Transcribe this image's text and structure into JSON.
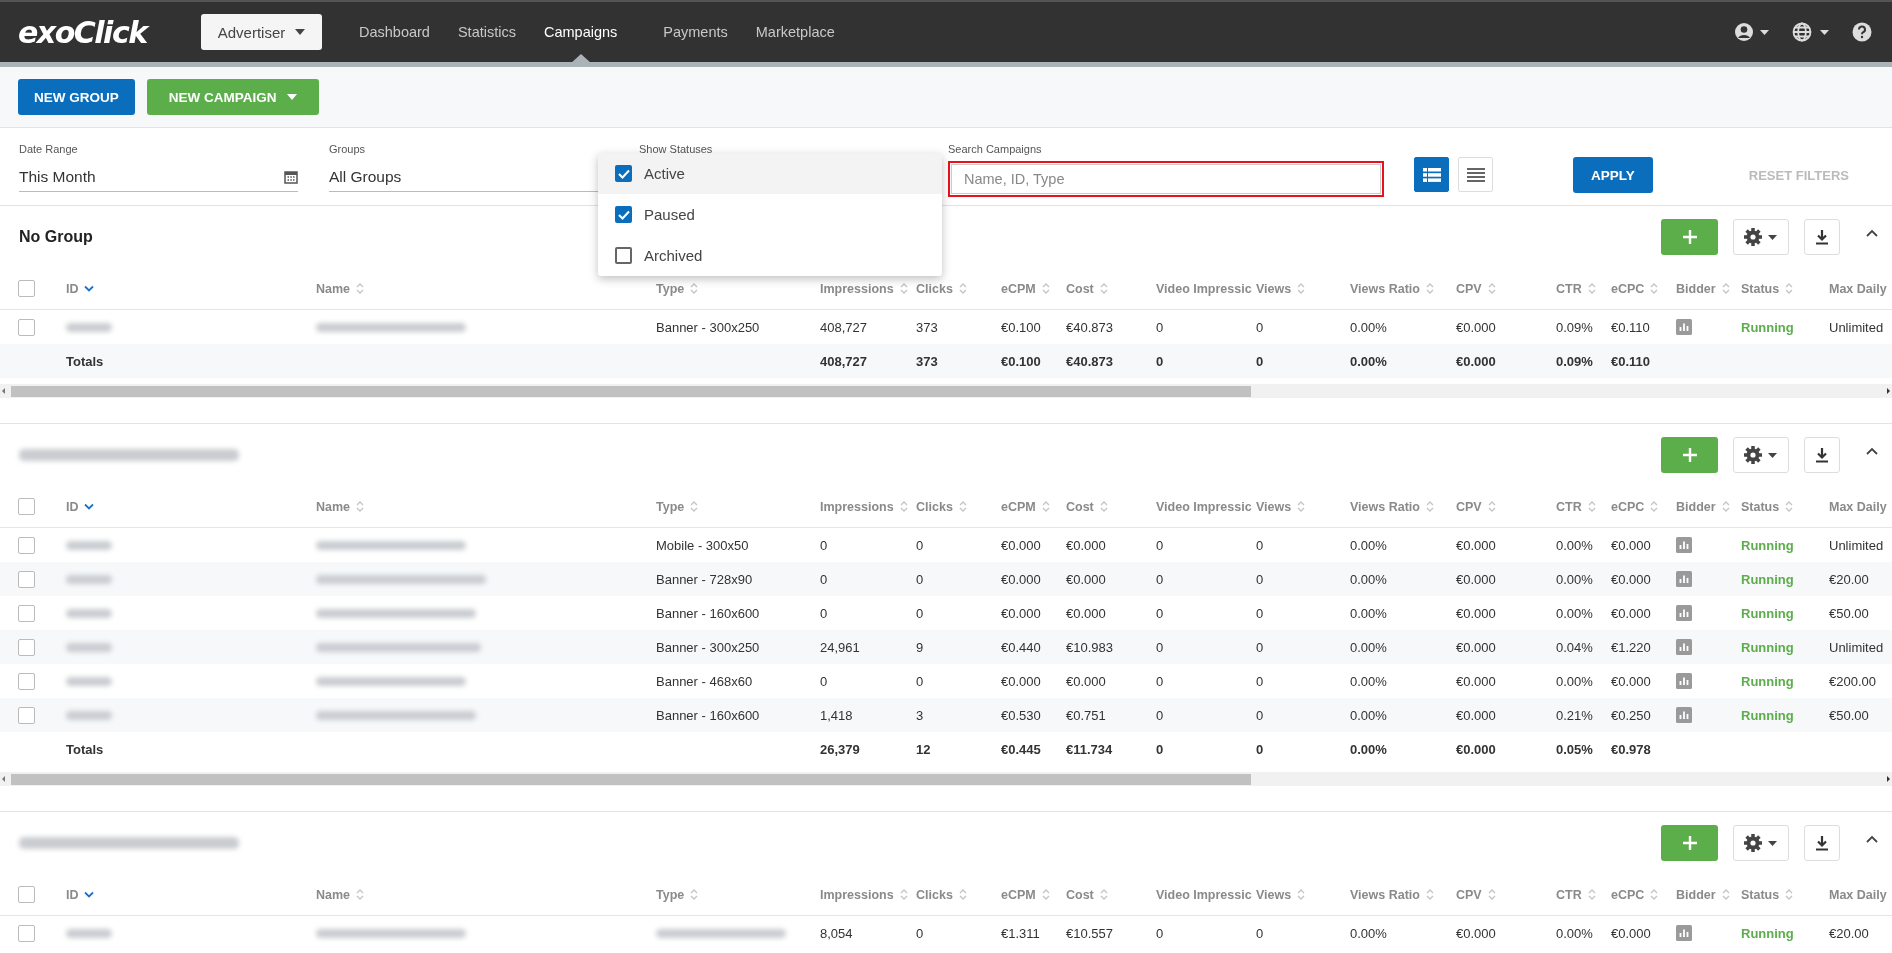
{
  "header": {
    "logo": "exoClick",
    "account_menu": "Advertiser",
    "nav": [
      {
        "label": "Dashboard",
        "selected": false
      },
      {
        "label": "Statistics",
        "selected": false
      },
      {
        "label": "Campaigns",
        "selected": true
      },
      {
        "label": "Payments",
        "selected": false
      },
      {
        "label": "Marketplace",
        "selected": false
      }
    ]
  },
  "toolbar": {
    "new_group": "NEW GROUP",
    "new_campaign": "NEW CAMPAIGN"
  },
  "filters": {
    "date_range": {
      "label": "Date Range",
      "value": "This Month"
    },
    "groups": {
      "label": "Groups",
      "value": "All Groups"
    },
    "show_statuses": {
      "label": "Show Statuses",
      "options": [
        {
          "label": "Active",
          "checked": true,
          "selected": true
        },
        {
          "label": "Paused",
          "checked": true,
          "selected": false
        },
        {
          "label": "Archived",
          "checked": false,
          "selected": false
        }
      ]
    },
    "search": {
      "label": "Search Campaigns",
      "placeholder": "Name, ID, Type"
    },
    "views": [
      {
        "kind": "cards",
        "selected": true
      },
      {
        "kind": "list",
        "selected": false
      }
    ],
    "apply": "APPLY",
    "reset": "RESET FILTERS"
  },
  "groups": [
    {
      "title": "No Group",
      "select_all_checked": false,
      "columns": [
        {
          "label": "ID",
          "sorted": true
        },
        {
          "label": "Name",
          "sorted": false
        },
        {
          "label": "Type",
          "sorted": false
        },
        {
          "label": "Impressions",
          "sorted": false
        },
        {
          "label": "Clicks",
          "sorted": false
        },
        {
          "label": "eCPM",
          "sorted": false
        },
        {
          "label": "Cost",
          "sorted": false
        },
        {
          "label": "Video Impressic"
        },
        {
          "label": "Views",
          "sorted": false
        },
        {
          "label": "Views Ratio",
          "sorted": false
        },
        {
          "label": "CPV",
          "sorted": false
        },
        {
          "label": "CTR",
          "sorted": false
        },
        {
          "label": "eCPC",
          "sorted": false
        },
        {
          "label": "Bidder",
          "sorted": false
        },
        {
          "label": "Status",
          "sorted": false
        },
        {
          "label": "Max Daily"
        }
      ],
      "rows": [
        {
          "checked": false,
          "type": "Banner - 300x250",
          "metrics": [
            "408,727",
            "373",
            "€0.100",
            "€40.873",
            "0",
            "0",
            "0.00%",
            "€0.000",
            "0.09%",
            "€0.110"
          ],
          "status": "Running",
          "max_daily": "Unlimited"
        }
      ],
      "totals": {
        "label": "Totals",
        "metrics": [
          "408,727",
          "373",
          "€0.100",
          "€40.873",
          "0",
          "0",
          "0.00%",
          "€0.000",
          "0.09%",
          "€0.110"
        ]
      }
    },
    {
      "select_all_checked": false,
      "columns": [
        {
          "label": "ID",
          "sorted": true
        },
        {
          "label": "Name",
          "sorted": false
        },
        {
          "label": "Type",
          "sorted": false
        },
        {
          "label": "Impressions",
          "sorted": false
        },
        {
          "label": "Clicks",
          "sorted": false
        },
        {
          "label": "eCPM",
          "sorted": false
        },
        {
          "label": "Cost",
          "sorted": false
        },
        {
          "label": "Video Impressic"
        },
        {
          "label": "Views",
          "sorted": false
        },
        {
          "label": "Views Ratio",
          "sorted": false
        },
        {
          "label": "CPV",
          "sorted": false
        },
        {
          "label": "CTR",
          "sorted": false
        },
        {
          "label": "eCPC",
          "sorted": false
        },
        {
          "label": "Bidder",
          "sorted": false
        },
        {
          "label": "Status",
          "sorted": false
        },
        {
          "label": "Max Daily"
        }
      ],
      "rows": [
        {
          "checked": false,
          "type": "Mobile - 300x50",
          "metrics": [
            "0",
            "0",
            "€0.000",
            "€0.000",
            "0",
            "0",
            "0.00%",
            "€0.000",
            "0.00%",
            "€0.000"
          ],
          "status": "Running",
          "max_daily": "Unlimited"
        },
        {
          "checked": false,
          "type": "Banner - 728x90",
          "metrics": [
            "0",
            "0",
            "€0.000",
            "€0.000",
            "0",
            "0",
            "0.00%",
            "€0.000",
            "0.00%",
            "€0.000"
          ],
          "status": "Running",
          "max_daily": "€20.00"
        },
        {
          "checked": false,
          "type": "Banner - 160x600",
          "metrics": [
            "0",
            "0",
            "€0.000",
            "€0.000",
            "0",
            "0",
            "0.00%",
            "€0.000",
            "0.00%",
            "€0.000"
          ],
          "status": "Running",
          "max_daily": "€50.00"
        },
        {
          "checked": false,
          "type": "Banner - 300x250",
          "metrics": [
            "24,961",
            "9",
            "€0.440",
            "€10.983",
            "0",
            "0",
            "0.00%",
            "€0.000",
            "0.04%",
            "€1.220"
          ],
          "status": "Running",
          "max_daily": "Unlimited"
        },
        {
          "checked": false,
          "type": "Banner - 468x60",
          "metrics": [
            "0",
            "0",
            "€0.000",
            "€0.000",
            "0",
            "0",
            "0.00%",
            "€0.000",
            "0.00%",
            "€0.000"
          ],
          "status": "Running",
          "max_daily": "€200.00"
        },
        {
          "checked": false,
          "type": "Banner - 160x600",
          "metrics": [
            "1,418",
            "3",
            "€0.530",
            "€0.751",
            "0",
            "0",
            "0.00%",
            "€0.000",
            "0.21%",
            "€0.250"
          ],
          "status": "Running",
          "max_daily": "€50.00"
        }
      ],
      "totals": {
        "label": "Totals",
        "metrics": [
          "26,379",
          "12",
          "€0.445",
          "€11.734",
          "0",
          "0",
          "0.00%",
          "€0.000",
          "0.05%",
          "€0.978"
        ]
      }
    },
    {
      "select_all_checked": false,
      "columns": [
        {
          "label": "ID",
          "sorted": true
        },
        {
          "label": "Name",
          "sorted": false
        },
        {
          "label": "Type",
          "sorted": false
        },
        {
          "label": "Impressions",
          "sorted": false
        },
        {
          "label": "Clicks",
          "sorted": false
        },
        {
          "label": "eCPM",
          "sorted": false
        },
        {
          "label": "Cost",
          "sorted": false
        },
        {
          "label": "Video Impressic"
        },
        {
          "label": "Views",
          "sorted": false
        },
        {
          "label": "Views Ratio",
          "sorted": false
        },
        {
          "label": "CPV",
          "sorted": false
        },
        {
          "label": "CTR",
          "sorted": false
        },
        {
          "label": "eCPC",
          "sorted": false
        },
        {
          "label": "Bidder",
          "sorted": false
        },
        {
          "label": "Status",
          "sorted": false
        },
        {
          "label": "Max Daily"
        }
      ],
      "rows": [
        {
          "checked": false,
          "metrics": [
            "8,054",
            "0",
            "€1.311",
            "€10.557",
            "0",
            "0",
            "0.00%",
            "€0.000",
            "0.00%",
            "€0.000"
          ],
          "status": "Running",
          "max_daily": "€20.00"
        }
      ]
    }
  ]
}
